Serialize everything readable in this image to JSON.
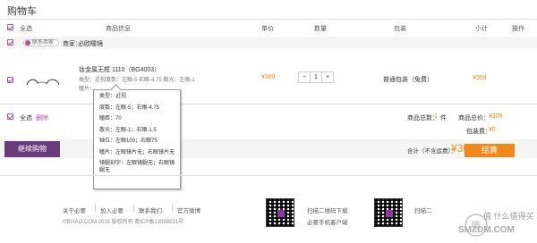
{
  "page": {
    "title": "购物车"
  },
  "header": {
    "select_all": "全选",
    "product": "商品信息",
    "price": "单价",
    "qty": "数量",
    "shipping": "包装",
    "subtotal": "小计",
    "ops": "操作"
  },
  "shop": {
    "contact": "联系商家",
    "label": "商家：",
    "name": "必欧瞳镜"
  },
  "item": {
    "name": "钛金属无框 1110（BG4003）",
    "spec_line1": "类型：近视度数：左眼-5 右眼-4.75 散光：左眼-1",
    "spec_line2": "瞳片：…",
    "price": "¥309",
    "qty": "1",
    "minus": "−",
    "plus": "+",
    "shipping": "普通包装（免费）",
    "subtotal": "¥309"
  },
  "popup": {
    "type": "类型：近视",
    "degree": "度数：左眼-5；右眼-4.75",
    "pd": "瞳距：70",
    "astig": "散光：左眼-1；右眼-1.5",
    "axis": "轴位：左眼100；右眼75",
    "lens": "瞳片：左眼镜片无；右眼镜片无",
    "engrave": "镜腿刻字：左眼镜腿无；右眼镜腿无"
  },
  "bottom": {
    "select_all": "全选",
    "delete": "删除",
    "goods_count_label": "商品总数：",
    "goods_count": "1",
    "goods_unit": "件",
    "goods_total_label": "商品总价：",
    "goods_total": "¥309",
    "pack_label": "包装费：",
    "pack": "¥0",
    "continue": "继续购物",
    "total_label": "合计（不含运费）：",
    "total": "¥309",
    "checkout": "结算"
  },
  "footer": {
    "links": [
      "关于必要",
      "加入必要",
      "联系我们",
      "官方微博"
    ],
    "copyright": "©BIYAO.COM 2015 版权所有 粤ICP备13068531号",
    "qr1_title": "扫描二维码下载",
    "qr1_sub": "必要手机客户端",
    "qr2_title": "扫描二",
    "watermark": "值 什么值得买",
    "watermark_url": "SMZDM.COM"
  },
  "colors": {
    "accent": "#b0509a",
    "checkout": "#f0891a",
    "continue": "#6b3a7a",
    "price": "#f0891a"
  }
}
